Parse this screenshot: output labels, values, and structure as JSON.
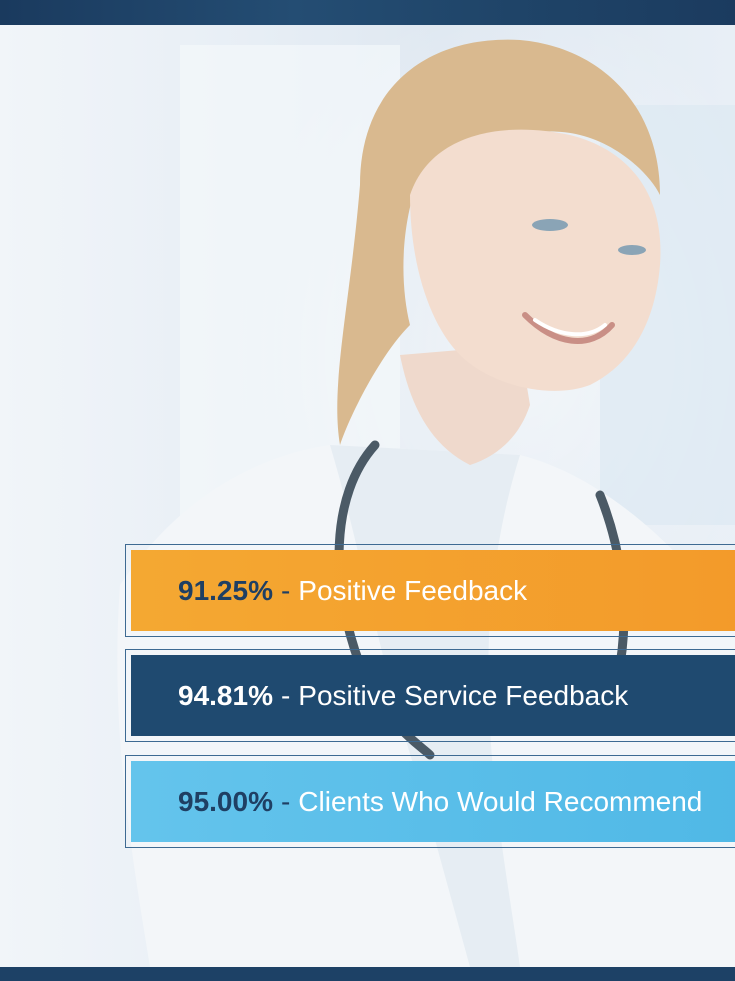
{
  "stats": [
    {
      "percent": "91.25%",
      "separator": "-",
      "label": "Positive Feedback",
      "color": "#f4a832"
    },
    {
      "percent": "94.81%",
      "separator": "-",
      "label": "Positive Service Feedback",
      "color": "#1f4a70"
    },
    {
      "percent": "95.00%",
      "separator": "-",
      "label": "Clients Who Would Recommend",
      "color": "#5cc0ea"
    }
  ],
  "hero": {
    "image": "smiling-doctor-with-stethoscope"
  },
  "colors": {
    "top_band": "#1f4468",
    "bottom_band": "#1d4166"
  }
}
